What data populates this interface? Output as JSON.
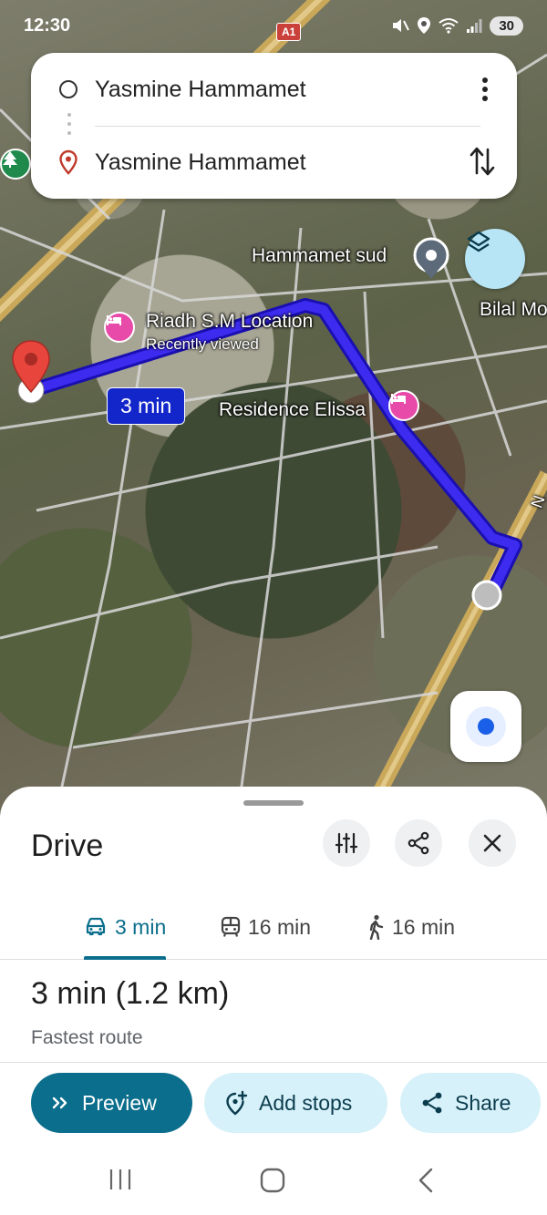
{
  "status_bar": {
    "time": "12:30",
    "battery": "30",
    "road_shield": "A1"
  },
  "directions": {
    "origin": "Yasmine Hammamet",
    "destination": "Yasmine Hammamet"
  },
  "map": {
    "labels": {
      "hammamet_sud": "Hammamet sud",
      "bilal": "Bilal Mo",
      "riadh": "Riadh S.M Location",
      "riadh_sub": "Recently viewed",
      "residence": "Residence Elissa",
      "road_partial": "N"
    },
    "route_time_badge": "3 min",
    "route_color": "#3d2cf0"
  },
  "sheet": {
    "title": "Drive",
    "tabs": [
      {
        "icon": "car-icon",
        "label": "3 min",
        "active": true
      },
      {
        "icon": "transit-icon",
        "label": "16 min",
        "active": false
      },
      {
        "icon": "walk-icon",
        "label": "16 min",
        "active": false
      }
    ],
    "summary": "3 min (1.2 km)",
    "subtitle": "Fastest route",
    "buttons": {
      "preview": "Preview",
      "add_stops": "Add stops",
      "share": "Share"
    },
    "accent_color": "#0b6e8c"
  }
}
